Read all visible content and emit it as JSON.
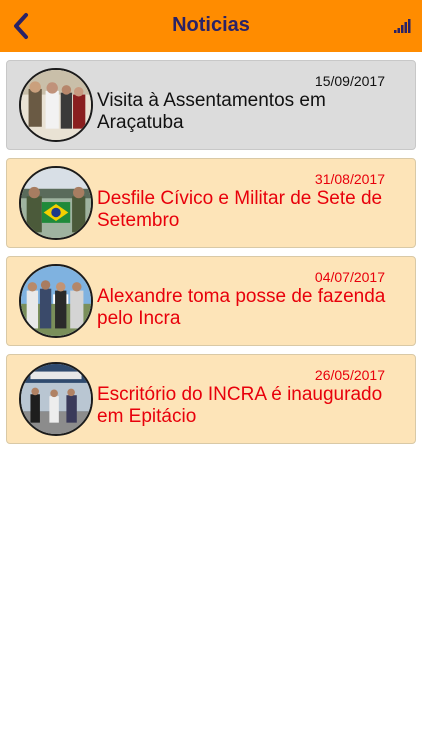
{
  "header": {
    "title": "Noticias",
    "back_icon": "chevron-left-icon",
    "status_icon": "signal-bars-icon"
  },
  "colors": {
    "header_bg": "#ff8c00",
    "title": "#2a2266",
    "read_bg": "#dcdcdc",
    "unread_bg": "#fde4b8",
    "unread_text": "#e8000b"
  },
  "news": [
    {
      "date": "15/09/2017",
      "title": "Visita à Assentamentos em Araçatuba",
      "state": "read"
    },
    {
      "date": "31/08/2017",
      "title": "Desfile Cívico e Militar de Sete de Setembro",
      "state": "unread"
    },
    {
      "date": "04/07/2017",
      "title": "Alexandre toma posse de fazenda pelo Incra",
      "state": "unread"
    },
    {
      "date": "26/05/2017",
      "title": "Escritório do INCRA é inaugurado em Epitácio",
      "state": "unread"
    }
  ]
}
